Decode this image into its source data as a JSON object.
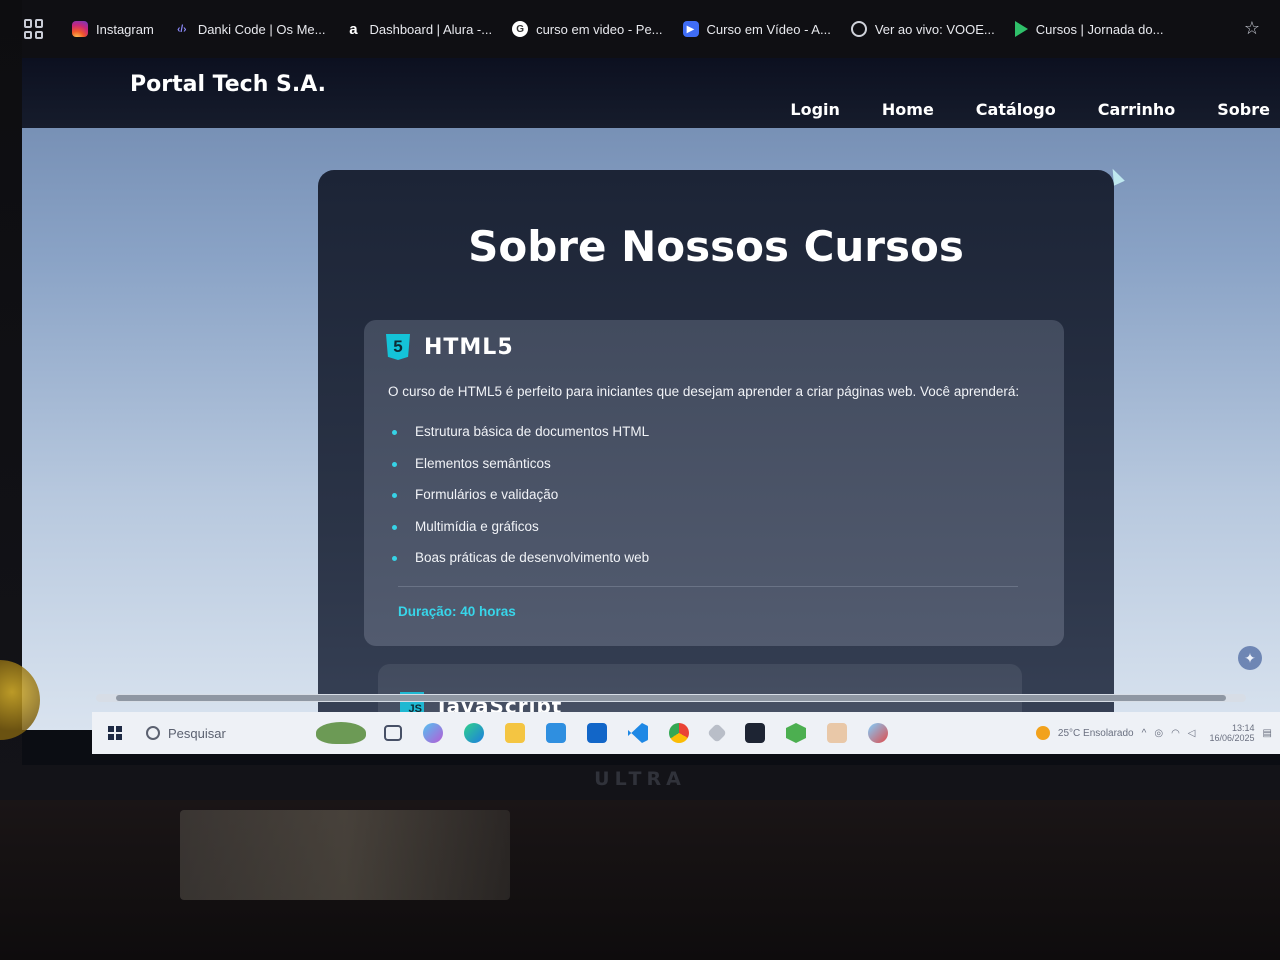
{
  "bookmarks": [
    {
      "label": "Instagram",
      "icon": "instagram-icon"
    },
    {
      "label": "Danki Code | Os Me...",
      "icon": "code-icon"
    },
    {
      "label": "Dashboard | Alura -...",
      "icon": "alura-icon"
    },
    {
      "label": "curso em video - Pe...",
      "icon": "google-icon"
    },
    {
      "label": "Curso em Vídeo - A...",
      "icon": "cursoemvideo-icon"
    },
    {
      "label": "Ver ao vivo: VOOE...",
      "icon": "globe-icon"
    },
    {
      "label": "Cursos | Jornada do...",
      "icon": "play-icon"
    }
  ],
  "site": {
    "logo": "Portal Tech S.A.",
    "nav": [
      "Login",
      "Home",
      "Catálogo",
      "Carrinho",
      "Sobre"
    ]
  },
  "main": {
    "title": "Sobre Nossos Cursos",
    "course": {
      "icon_text": "5",
      "name": "HTML5",
      "description": "O curso de HTML5 é perfeito para iniciantes que desejam aprender a criar páginas web. Você aprenderá:",
      "topics": [
        "Estrutura básica de documentos HTML",
        "Elementos semânticos",
        "Formulários e validação",
        "Multimídia e gráficos",
        "Boas práticas de desenvolvimento web"
      ],
      "duration": "Duração: 40 horas"
    },
    "course2": {
      "icon_text": "JS",
      "name": "JavaScript"
    }
  },
  "taskbar": {
    "search_placeholder": "Pesquisar",
    "weather": "25°C  Ensolarado",
    "time": "13:14",
    "date": "16/06/2025"
  },
  "monitor_brand": "ULTRA",
  "colors": {
    "accent": "#36d3e6",
    "card": "#2b3447",
    "header": "#0c1020"
  }
}
